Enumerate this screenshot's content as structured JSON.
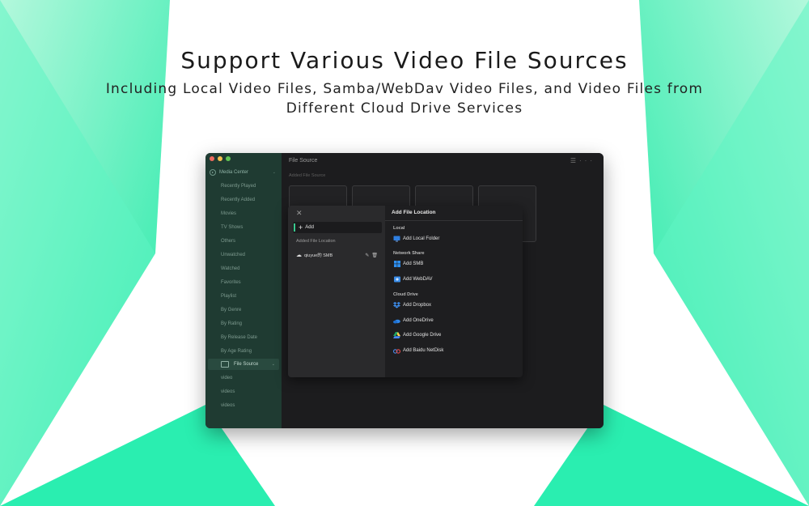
{
  "headline": "Support Various Video File Sources",
  "subheadline": "Including Local Video Files, Samba/WebDav Video Files, and Video Files from Different Cloud Drive Services",
  "colors": {
    "accent_green": "#39c98e",
    "sidebar_bg": "#1f3b32",
    "background_gradient_start": "#2ef0b0",
    "background_gradient_end": "#a6f7d6"
  },
  "window": {
    "traffic_lights": [
      "#ed6a5e",
      "#f5bf4f",
      "#61c554"
    ],
    "sidebar": {
      "group_label": "Media Center",
      "group_icon": "media-center-icon",
      "items": [
        "Recently Played",
        "Recently Added",
        "Movies",
        "TV Shows",
        "Others",
        "Unwatched",
        "Watched",
        "Favorites",
        "Playlist",
        "By Genre",
        "By Rating",
        "By Release Date",
        "By Age Rating"
      ],
      "file_source_label": "File Source",
      "file_source_icon": "folder-icon",
      "sub_items": [
        "video",
        "videos",
        "videos"
      ]
    },
    "main": {
      "title": "File Source",
      "section_label": "Added File Source",
      "toolbar_icons": [
        "list-view-icon",
        "more-icon"
      ]
    }
  },
  "dialog": {
    "add_label": "Add",
    "added_label": "Added File Location",
    "location": {
      "name": "qiuyue的 SMB",
      "icon": "cloud-icon"
    },
    "title": "Add File Location",
    "sections": {
      "local": {
        "label": "Local",
        "options": [
          {
            "label": "Add Local Folder",
            "icon": "monitor-icon"
          }
        ]
      },
      "network": {
        "label": "Network Share",
        "options": [
          {
            "label": "Add SMB",
            "icon": "windows-icon"
          },
          {
            "label": "Add WebDAV",
            "icon": "webdav-folder-icon"
          }
        ]
      },
      "cloud": {
        "label": "Cloud Drive",
        "options": [
          {
            "label": "Add Dropbox",
            "icon": "dropbox-icon"
          },
          {
            "label": "Add OneDrive",
            "icon": "onedrive-icon"
          },
          {
            "label": "Add Google Drive",
            "icon": "google-drive-icon"
          },
          {
            "label": "Add Baidu NetDisk",
            "icon": "baidu-netdisk-icon"
          }
        ]
      }
    }
  }
}
